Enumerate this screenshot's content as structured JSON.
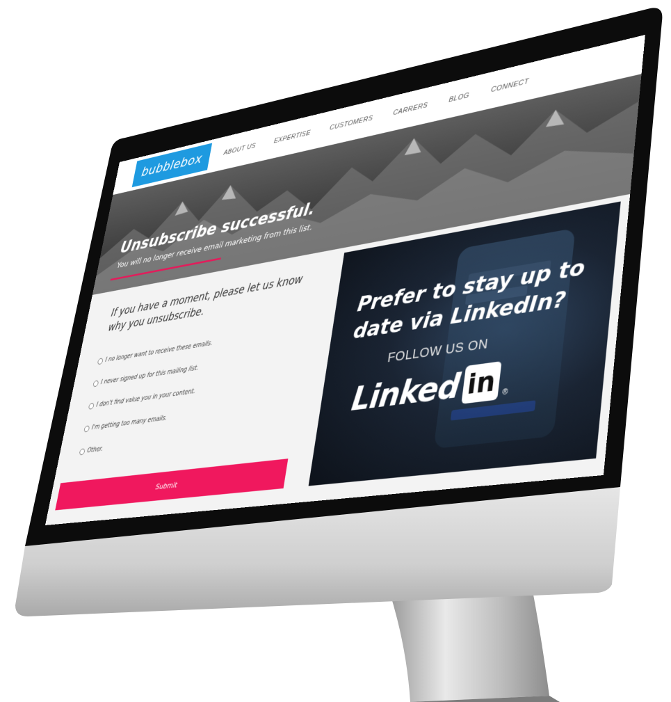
{
  "site": {
    "logo": "bubblebox",
    "nav": [
      "ABOUT US",
      "EXPERTISE",
      "CUSTOMERS",
      "CARRERS",
      "BLOG",
      "CONNECT"
    ],
    "hero": {
      "title": "Unsubscribe successful.",
      "subtitle": "You will no longer receive email marketing from this list."
    },
    "form": {
      "question": "If you have a moment, please let us know why you unsubscribe.",
      "options": [
        "I no longer want to receive these emails.",
        "I never signed up for this mailing list.",
        "I don't find value you in your content.",
        "I'm getting too many emails.",
        "Other."
      ],
      "submit": "Submit"
    },
    "promo": {
      "headline": "Prefer to stay up to date via LinkedIn?",
      "follow": "FOLLOW US ON",
      "brand_word": "Linked",
      "brand_box": "in",
      "brand_reg": "®"
    }
  },
  "colors": {
    "logo_bg": "#1e9ae0",
    "accent": "#f0185e",
    "bezel": "#0d0d0d",
    "chin": "#d8d8d8"
  }
}
